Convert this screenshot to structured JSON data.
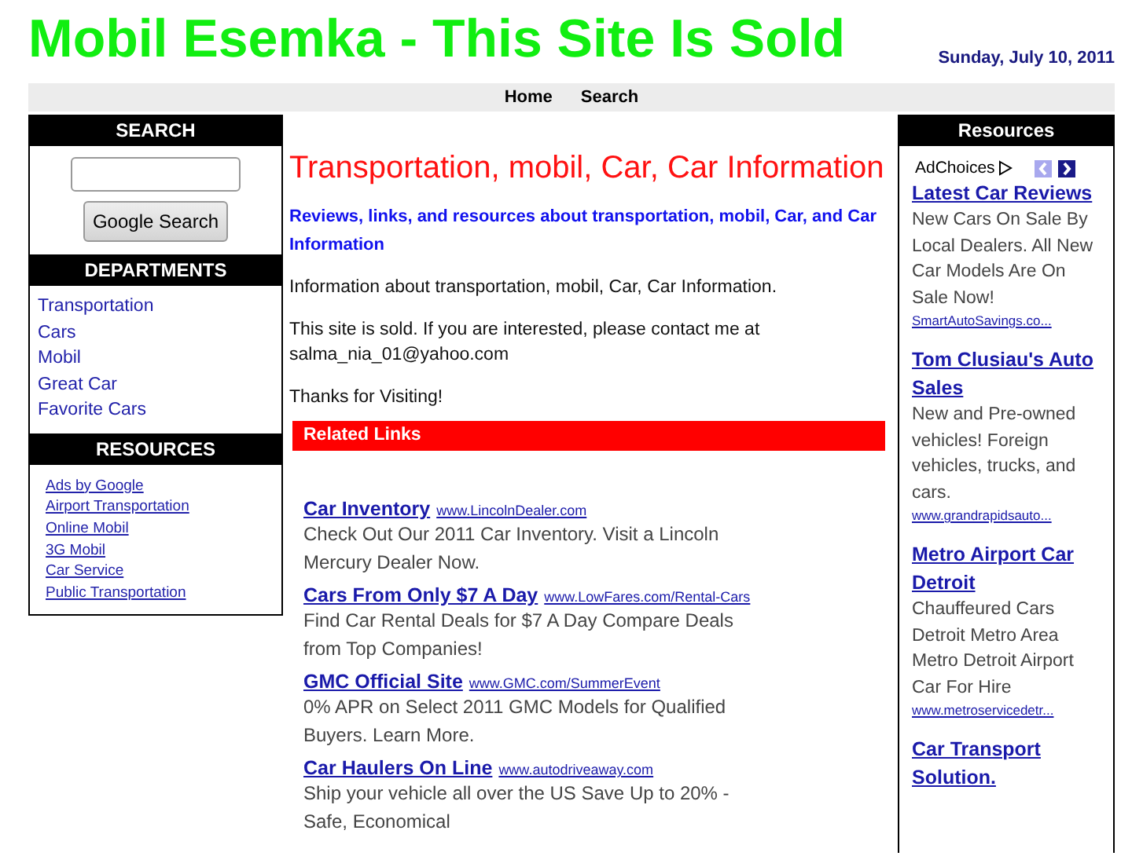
{
  "header": {
    "title": "Mobil Esemka - This Site Is Sold",
    "date": "Sunday, July 10, 2011"
  },
  "nav": [
    "Home",
    "Search"
  ],
  "left": {
    "search": {
      "heading": "SEARCH",
      "button": "Google Search"
    },
    "departments": {
      "heading": "DEPARTMENTS",
      "items": [
        "Transportation",
        "Cars",
        "Mobil",
        "Great Car",
        "Favorite Cars"
      ]
    },
    "resources": {
      "heading": "RESOURCES",
      "ads_label": "Ads by Google",
      "items": [
        "Airport Transportation",
        "Online Mobil",
        "3G Mobil",
        "Car Service",
        "Public Transportation"
      ]
    }
  },
  "main": {
    "title": "Transportation, mobil, Car, Car Information",
    "subtitle": "Reviews, links, and resources about transportation, mobil, Car, and Car Information",
    "paragraphs": [
      "Information about transportation, mobil, Car, Car Information.",
      "This site is sold. If you are interested, please contact me at salma_nia_01@yahoo.com",
      "Thanks for Visiting!"
    ],
    "related_heading": "Related Links",
    "ads": [
      {
        "title": "Car Inventory",
        "url": "www.LincolnDealer.com",
        "description": "Check Out Our 2011 Car Inventory. Visit a Lincoln Mercury Dealer Now."
      },
      {
        "title": "Cars From Only $7 A Day",
        "url": "www.LowFares.com/Rental-Cars",
        "description": "Find Car Rental Deals for $7 A Day Compare Deals from Top Companies!"
      },
      {
        "title": "GMC Official Site",
        "url": "www.GMC.com/SummerEvent",
        "description": "0% APR on Select 2011 GMC Models for Qualified Buyers. Learn More."
      },
      {
        "title": "Car Haulers On Line",
        "url": "www.autodriveaway.com",
        "description": "Ship your vehicle all over the US Save Up to 20% - Safe, Economical"
      }
    ]
  },
  "right": {
    "heading": "Resources",
    "adchoices": "AdChoices",
    "ads": [
      {
        "title": "Latest Car Reviews",
        "description": "New Cars On Sale By Local Dealers. All New Car Models Are On Sale Now!",
        "url": "SmartAutoSavings.co..."
      },
      {
        "title": "Tom Clusiau's Auto Sales",
        "description": "New and Pre-owned vehicles! Foreign vehicles, trucks, and cars.",
        "url": "www.grandrapidsauto..."
      },
      {
        "title": "Metro Airport Car Detroit",
        "description": "Chauffeured Cars Detroit Metro Area Metro Detroit Airport Car For Hire",
        "url": "www.metroservicedetr..."
      },
      {
        "title": "Car Transport Solution."
      }
    ]
  }
}
